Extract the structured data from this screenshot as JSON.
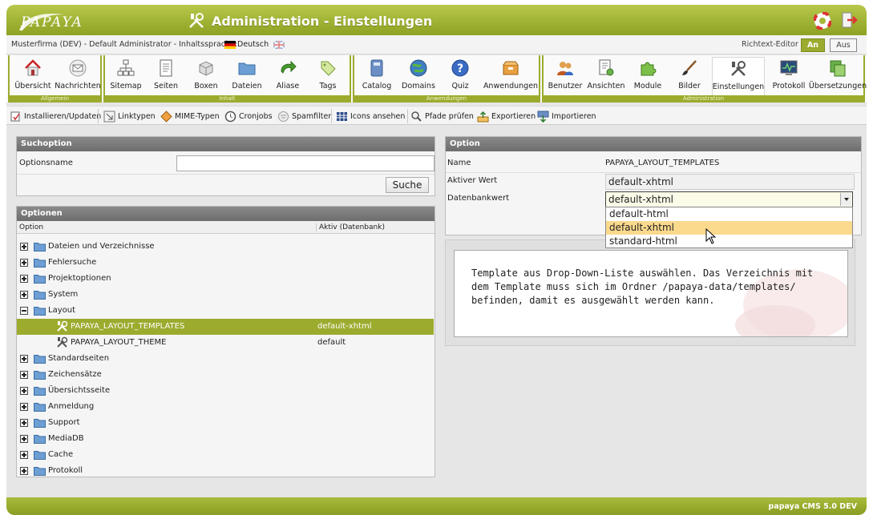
{
  "header": {
    "logo_text": "PAPAYA",
    "title": "Administration - Einstellungen"
  },
  "infobar": {
    "text": "Musterfirma (DEV) - Default Administrator - Inhaltssprache:",
    "language": "Deutsch",
    "rte_label": "Richtext-Editor",
    "rte_on": "An",
    "rte_off": "Aus"
  },
  "toolbar": {
    "groups": [
      {
        "label": "Allgemein",
        "items": [
          {
            "label": "Übersicht",
            "icon": "home-icon"
          },
          {
            "label": "Nachrichten",
            "icon": "mail-icon"
          }
        ]
      },
      {
        "label": "Inhalt",
        "items": [
          {
            "label": "Sitemap",
            "icon": "sitemap-icon"
          },
          {
            "label": "Seiten",
            "icon": "page-icon"
          },
          {
            "label": "Boxen",
            "icon": "boxes-icon"
          },
          {
            "label": "Dateien",
            "icon": "folder-icon"
          },
          {
            "label": "Aliase",
            "icon": "alias-icon"
          },
          {
            "label": "Tags",
            "icon": "tags-icon"
          }
        ]
      },
      {
        "label": "Anwendungen",
        "items": [
          {
            "label": "Catalog",
            "icon": "catalog-icon"
          },
          {
            "label": "Domains",
            "icon": "domains-icon"
          },
          {
            "label": "Quiz",
            "icon": "quiz-icon"
          },
          {
            "label": "Anwendungen",
            "icon": "applications-icon"
          }
        ]
      },
      {
        "label": "Administration",
        "items": [
          {
            "label": "Benutzer",
            "icon": "users-icon"
          },
          {
            "label": "Ansichten",
            "icon": "views-icon"
          },
          {
            "label": "Module",
            "icon": "modules-icon"
          },
          {
            "label": "Bilder",
            "icon": "images-icon"
          },
          {
            "label": "Einstellungen",
            "icon": "settings-icon"
          },
          {
            "label": "Protokoll",
            "icon": "log-icon"
          },
          {
            "label": "Übersetzungen",
            "icon": "translations-icon"
          }
        ]
      }
    ]
  },
  "subtoolbar": [
    {
      "label": "Installieren/Updaten",
      "icon": "install-icon"
    },
    {
      "label": "Linktypen",
      "icon": "linktypes-icon"
    },
    {
      "label": "MIME-Typen",
      "icon": "mime-icon"
    },
    {
      "label": "Cronjobs",
      "icon": "clock-icon"
    },
    {
      "label": "Spamfilter",
      "icon": "spamfilter-icon"
    },
    {
      "label": "Icons ansehen",
      "icon": "icons-grid-icon"
    },
    {
      "label": "Pfade prüfen",
      "icon": "check-paths-icon"
    },
    {
      "label": "Exportieren",
      "icon": "export-icon"
    },
    {
      "label": "Importieren",
      "icon": "import-icon"
    }
  ],
  "search_panel": {
    "title": "Suchoption",
    "label": "Optionsname",
    "value": "",
    "button": "Suche"
  },
  "options_panel": {
    "title": "Optionen",
    "col_option": "Option",
    "col_active": "Aktiv (Datenbank)",
    "rows": [
      {
        "label": "Dateien und Verzeichnisse",
        "value": ""
      },
      {
        "label": "Fehlersuche",
        "value": ""
      },
      {
        "label": "Projektoptionen",
        "value": ""
      },
      {
        "label": "System",
        "value": ""
      },
      {
        "label": "Layout",
        "value": ""
      },
      {
        "label": "PAPAYA_LAYOUT_TEMPLATES",
        "value": "default-xhtml"
      },
      {
        "label": "PAPAYA_LAYOUT_THEME",
        "value": "default"
      },
      {
        "label": "Standardseiten",
        "value": ""
      },
      {
        "label": "Zeichensätze",
        "value": ""
      },
      {
        "label": "Übersichtsseite",
        "value": ""
      },
      {
        "label": "Anmeldung",
        "value": ""
      },
      {
        "label": "Support",
        "value": ""
      },
      {
        "label": "MediaDB",
        "value": ""
      },
      {
        "label": "Cache",
        "value": ""
      },
      {
        "label": "Protokoll",
        "value": ""
      }
    ]
  },
  "option_panel": {
    "title": "Option",
    "name_label": "Name",
    "name_value": "PAPAYA_LAYOUT_TEMPLATES",
    "active_label": "Aktiver Wert",
    "active_value": "default-xhtml",
    "db_label": "Datenbankwert",
    "db_value": "default-xhtml",
    "dropdown_options": [
      "default-html",
      "default-xhtml",
      "standard-html"
    ]
  },
  "help_text": "Template aus Drop-Down-Liste auswählen. Das Verzeichnis mit dem Template muss sich im Ordner /papaya-data/templates/ befinden, damit es ausgewählt werden kann.",
  "footer": {
    "text": "papaya CMS 5.0 DEV"
  },
  "colors": {
    "accent": "#9cab2e",
    "header": "#a6b83a",
    "highlight": "#fbd98d"
  }
}
